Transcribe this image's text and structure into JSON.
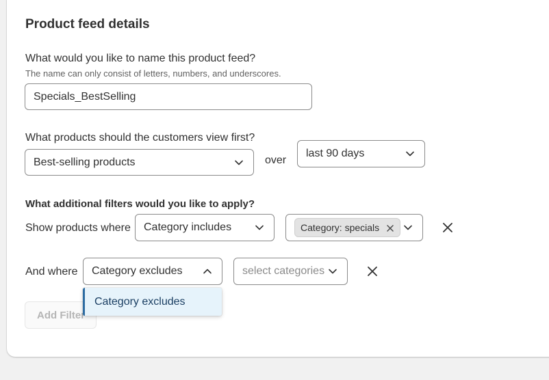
{
  "section": {
    "title": "Product feed details"
  },
  "feed_name": {
    "question": "What would you like to name this product feed?",
    "help": "The name can only consist of letters, numbers, and underscores.",
    "value": "Specials_BestSelling"
  },
  "sort": {
    "question": "What products should the customers view first?",
    "selected": "Best-selling products",
    "over_label": "over",
    "period": "last 90 days"
  },
  "filters": {
    "question": "What additional filters would you like to apply?",
    "rows": [
      {
        "prefix": "Show products where",
        "condition": "Category includes",
        "tag": "Category: specials"
      },
      {
        "prefix": "And where",
        "condition": "Category excludes",
        "value_placeholder": "select categories"
      }
    ],
    "dropdown_options": [
      "Category excludes"
    ],
    "add_button": "Add Filter"
  },
  "colors": {
    "accent": "#2d6ca2",
    "dropdown_bg": "#e6f3fb",
    "border": "#8a8a8a"
  }
}
